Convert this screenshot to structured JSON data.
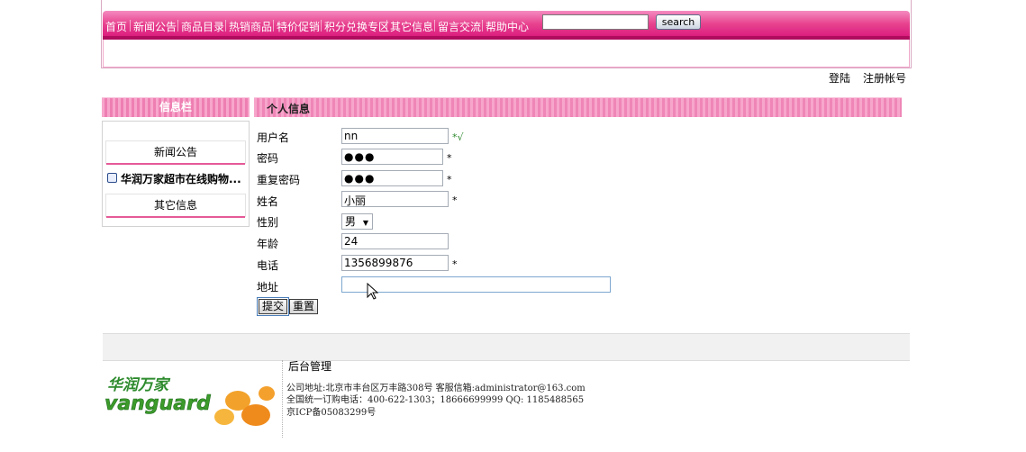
{
  "nav": {
    "items": [
      "首页",
      "新闻公告",
      "商品目录",
      "热销商品",
      "特价促销",
      "积分兑换专区",
      "其它信息",
      "留言交流",
      "帮助中心"
    ],
    "search_value": "",
    "search_label": "search"
  },
  "account": {
    "login": "登陆",
    "register": "注册帐号"
  },
  "sidebar": {
    "title": "信息栏",
    "tab_news": "新闻公告",
    "news_item": "华润万家超市在线购物...",
    "tab_other": "其它信息"
  },
  "main": {
    "title": "个人信息",
    "form": {
      "username_label": "用户名",
      "username_value": "nn",
      "username_mark": "*√",
      "password_label": "密码",
      "password_value": "●●●",
      "password_mark": "*",
      "repassword_label": "重复密码",
      "repassword_value": "●●●",
      "repassword_mark": "*",
      "name_label": "姓名",
      "name_value": "小丽",
      "name_mark": "*",
      "gender_label": "性别",
      "gender_value": "男",
      "age_label": "年龄",
      "age_value": "24",
      "phone_label": "电话",
      "phone_value": "1356899876",
      "phone_mark": "*",
      "address_label": "地址",
      "address_value": "",
      "submit_label": "提交",
      "reset_label": "重置"
    }
  },
  "footer": {
    "admin_label": "后台管理",
    "logo_cn": "华润万家",
    "logo_en": "vanguard",
    "address_line": "公司地址:北京市丰台区万丰路308号   客服信箱:administrator@163.com",
    "phone_line": "全国统一订购电话：400-622-1303；18666699999   QQ: 1185488565",
    "icp_line": "京ICP备05083299号"
  },
  "colors": {
    "accent": "#e8438f",
    "accent_dark": "#d8137a",
    "light_pink": "#f7a6cb"
  }
}
